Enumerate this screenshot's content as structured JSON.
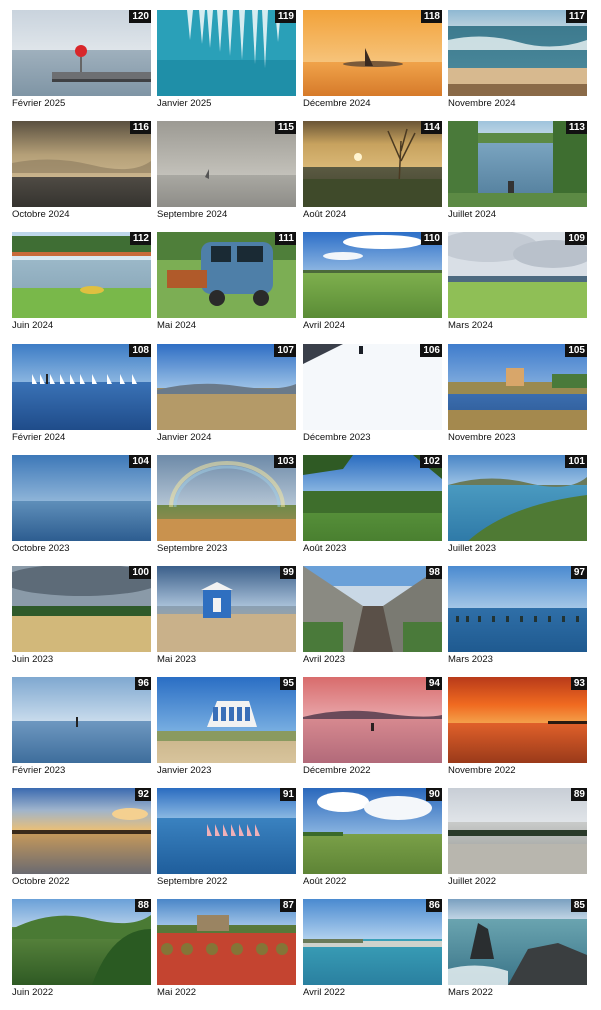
{
  "gallery": {
    "items": [
      {
        "number": "120",
        "caption": "Février 2025",
        "scene": "pier-buoy"
      },
      {
        "number": "119",
        "caption": "Janvier 2025",
        "scene": "icicles-water"
      },
      {
        "number": "118",
        "caption": "Décembre 2024",
        "scene": "orange-sailboat"
      },
      {
        "number": "117",
        "caption": "Novembre 2024",
        "scene": "waves-beach"
      },
      {
        "number": "116",
        "caption": "Octobre 2024",
        "scene": "stormy-sea"
      },
      {
        "number": "115",
        "caption": "Septembre 2024",
        "scene": "fog-sea"
      },
      {
        "number": "114",
        "caption": "Août 2024",
        "scene": "sunset-plant"
      },
      {
        "number": "113",
        "caption": "Juillet 2024",
        "scene": "pond-reeds"
      },
      {
        "number": "112",
        "caption": "Juin 2024",
        "scene": "lakeside-lawn"
      },
      {
        "number": "111",
        "caption": "Mai 2024",
        "scene": "old-truck"
      },
      {
        "number": "110",
        "caption": "Avril 2024",
        "scene": "green-field"
      },
      {
        "number": "109",
        "caption": "Mars 2024",
        "scene": "cloudy-field"
      },
      {
        "number": "108",
        "caption": "Février 2024",
        "scene": "sailboats"
      },
      {
        "number": "107",
        "caption": "Janvier 2024",
        "scene": "reeds-mountains"
      },
      {
        "number": "106",
        "caption": "Décembre 2023",
        "scene": "snow-slope"
      },
      {
        "number": "105",
        "caption": "Novembre 2023",
        "scene": "marsh-house"
      },
      {
        "number": "104",
        "caption": "Octobre 2023",
        "scene": "blue-haze"
      },
      {
        "number": "103",
        "caption": "Septembre 2023",
        "scene": "rainbow"
      },
      {
        "number": "102",
        "caption": "Août 2023",
        "scene": "vineyard"
      },
      {
        "number": "101",
        "caption": "Juillet 2023",
        "scene": "coast-hills"
      },
      {
        "number": "100",
        "caption": "Juin 2023",
        "scene": "wheat-field"
      },
      {
        "number": "99",
        "caption": "Mai 2023",
        "scene": "beach-cabin"
      },
      {
        "number": "98",
        "caption": "Avril 2023",
        "scene": "bridge"
      },
      {
        "number": "97",
        "caption": "Mars 2023",
        "scene": "oyster-posts"
      },
      {
        "number": "96",
        "caption": "Février 2023",
        "scene": "calm-lagoon"
      },
      {
        "number": "95",
        "caption": "Janvier 2023",
        "scene": "white-building"
      },
      {
        "number": "94",
        "caption": "Décembre 2022",
        "scene": "pink-dawn"
      },
      {
        "number": "93",
        "caption": "Novembre 2022",
        "scene": "fiery-sunset"
      },
      {
        "number": "92",
        "caption": "Octobre 2022",
        "scene": "golden-sunset"
      },
      {
        "number": "91",
        "caption": "Septembre 2022",
        "scene": "windsurfers"
      },
      {
        "number": "90",
        "caption": "Août 2022",
        "scene": "clouds-field"
      },
      {
        "number": "89",
        "caption": "Juillet 2022",
        "scene": "salt-marsh"
      },
      {
        "number": "88",
        "caption": "Juin 2022",
        "scene": "green-hills"
      },
      {
        "number": "87",
        "caption": "Mai 2022",
        "scene": "poppies-ruin"
      },
      {
        "number": "86",
        "caption": "Avril 2022",
        "scene": "breakwater"
      },
      {
        "number": "85",
        "caption": "Mars 2022",
        "scene": "rocks-sea"
      }
    ]
  }
}
